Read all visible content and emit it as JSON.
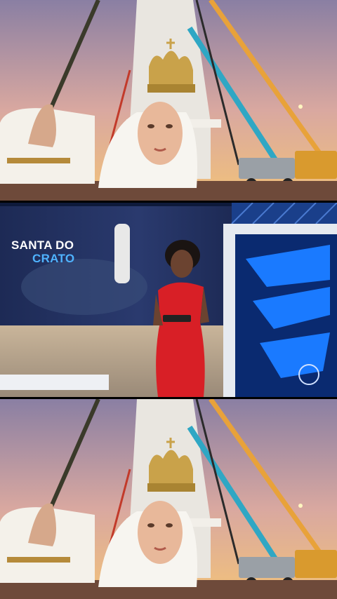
{
  "scene": {
    "top_image": "statue-head-construction-site",
    "middle_image": "news-studio-presenter",
    "bottom_image": "statue-head-construction-site"
  },
  "studio": {
    "title_line1": "SANTA DO",
    "title_line2": "CRATO"
  },
  "colors": {
    "sky_top": "#8a7fa3",
    "sky_bottom": "#f2c27a",
    "crane_blue": "#2fa7c4",
    "crane_orange": "#e8a23a",
    "dress_red": "#d81f26",
    "studio_blue": "#1a5fd8",
    "caption_blue": "#4fb3ff"
  }
}
